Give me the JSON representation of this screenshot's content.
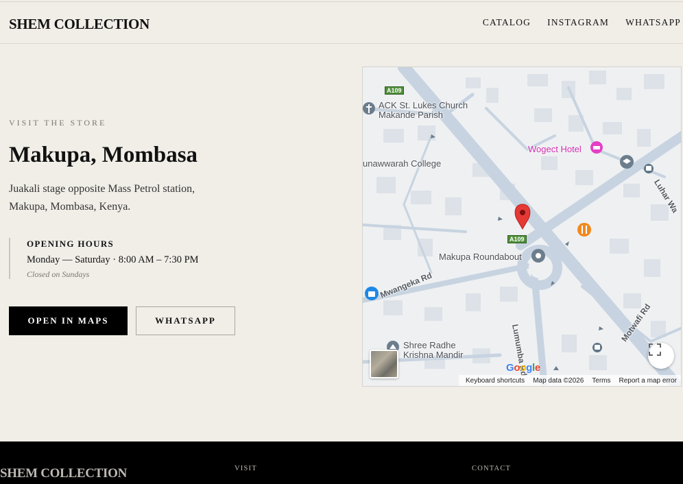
{
  "header": {
    "brand": "SHEM COLLECTION",
    "nav": [
      "CATALOG",
      "INSTAGRAM",
      "WHATSAPP"
    ]
  },
  "visit": {
    "kicker": "VISIT THE STORE",
    "title": "Makupa, Mombasa",
    "address": "Juakali stage opposite Mass Petrol station, Makupa, Mombasa, Kenya.",
    "hours_title": "OPENING HOURS",
    "hours": "Monday — Saturday · 8:00 AM – 7:30 PM",
    "hours_note": "Closed on Sundays",
    "primary_button": "OPEN IN MAPS",
    "secondary_button": "WHATSAPP"
  },
  "map": {
    "places": {
      "church": "ACK St. Lukes Church",
      "church2": "Makande Parish",
      "hotel": "Wogect Hotel",
      "college": "unawwarah College",
      "roundabout": "Makupa Roundabout",
      "temple": "Shree Radhe",
      "temple2": "Krishna Mandir"
    },
    "roads": {
      "mwangeka": "Mwangeka Rd",
      "lumumba": "Lumumba Rd",
      "motwafi": "Motwafi Rd",
      "luhar": "Luhar Wa",
      "shield1": "A109",
      "shield2": "A109"
    },
    "logo": "Google",
    "attribution": [
      "Keyboard shortcuts",
      "Map data ©2026",
      "Terms",
      "Report a map error"
    ],
    "colors": {
      "road": "#c7d3e0",
      "pin": "#e53935",
      "hotel": "#e53ec4",
      "restaurant": "#f2891d",
      "bus": "#5f7586"
    }
  },
  "footer": {
    "brand": "SHEM COLLECTION",
    "visit": "VISIT",
    "contact": "CONTACT"
  }
}
